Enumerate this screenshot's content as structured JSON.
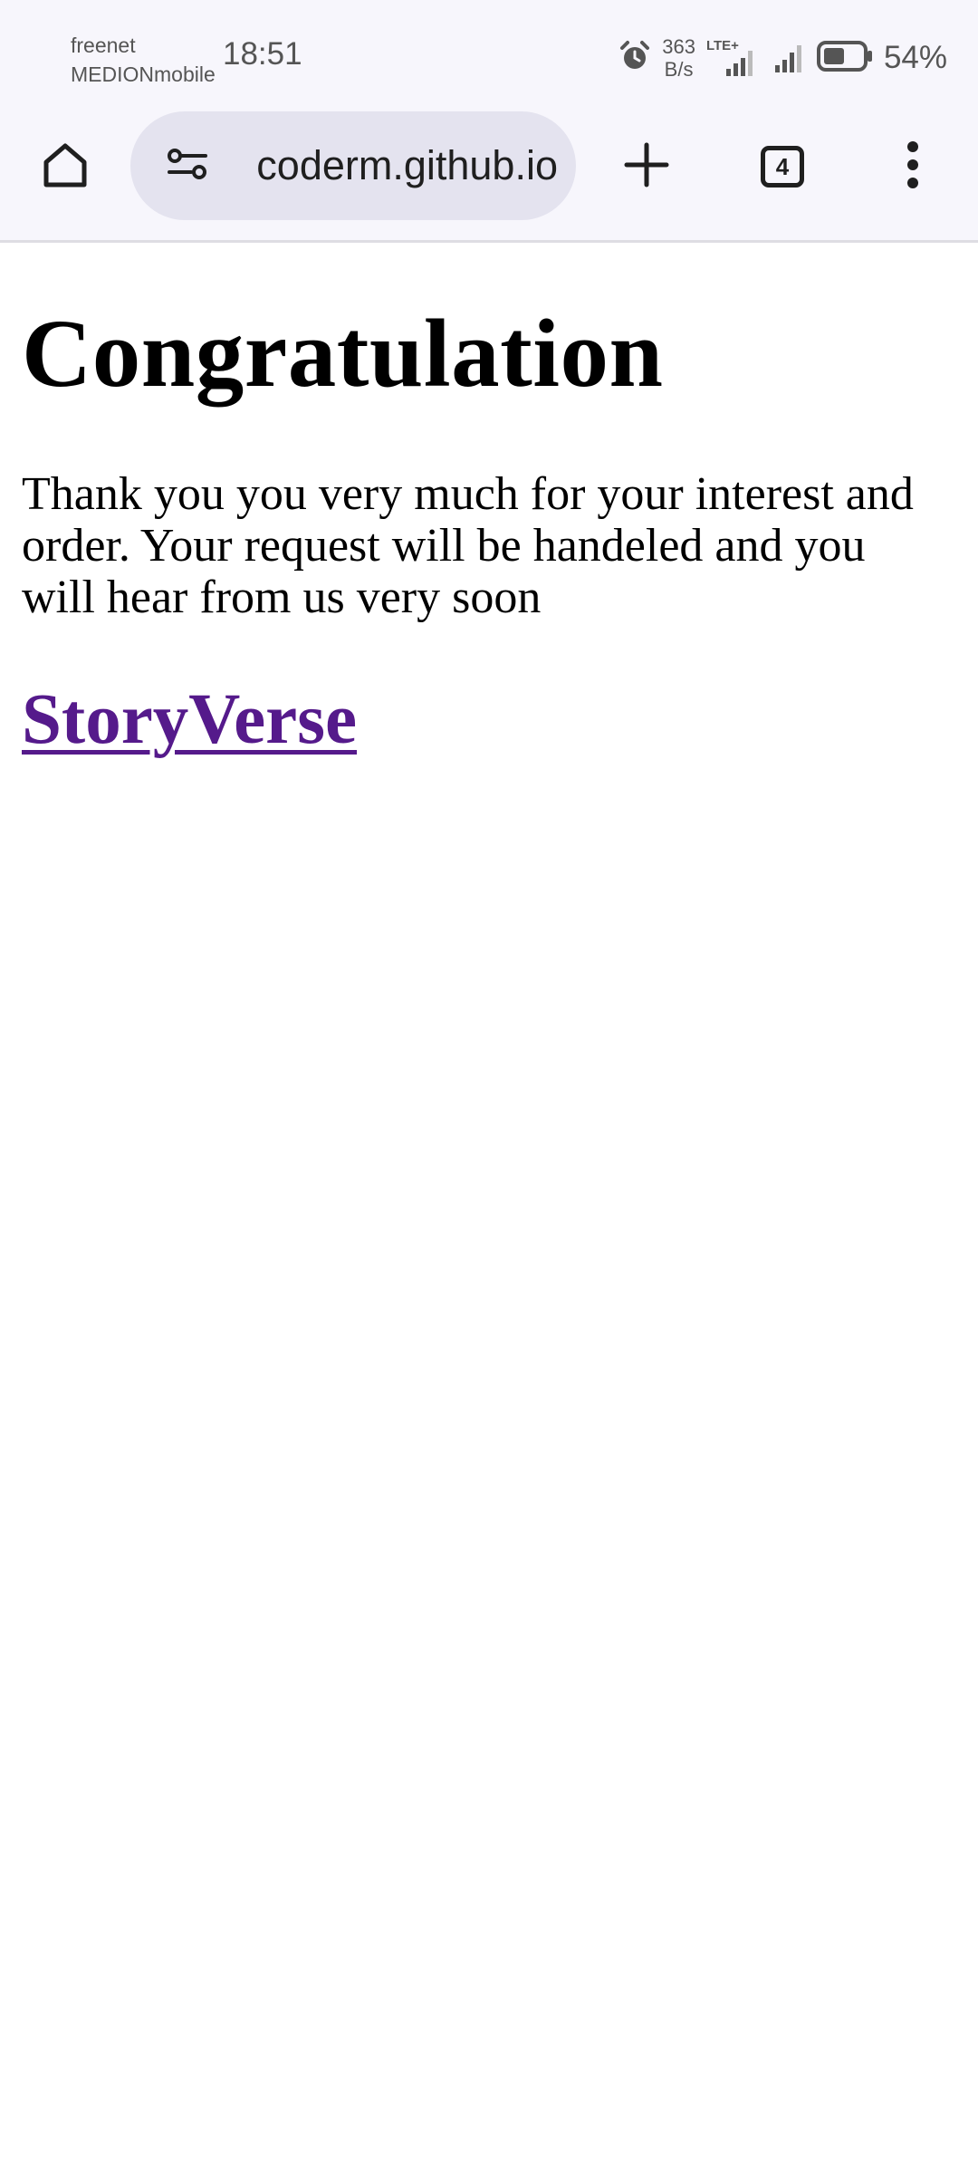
{
  "status_bar": {
    "carrier_line1": "freenet",
    "carrier_line2": "MEDIONmobile",
    "time": "18:51",
    "net_speed_value": "363",
    "net_speed_unit": "B/s",
    "network_type": "LTE+",
    "battery_percent": "54%",
    "battery_level": 0.54,
    "icons": [
      "alarm-icon",
      "lte-signal-icon",
      "signal-icon",
      "battery-icon"
    ]
  },
  "toolbar": {
    "url": "coderm.github.io",
    "tab_count": "4",
    "icons": [
      "home-icon",
      "site-settings-icon",
      "plus-icon",
      "tabs-icon",
      "more-vert-icon"
    ]
  },
  "page": {
    "title": "Congratulation",
    "message": "Thank you you very much for your interest and order. Your request will be handeled and you will hear from us very soon",
    "link_text": "StoryVerse",
    "link_color": "#551a8b"
  }
}
